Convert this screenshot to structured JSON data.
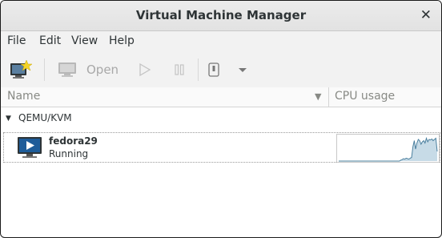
{
  "window": {
    "title": "Virtual Machine Manager"
  },
  "menu": {
    "file": "File",
    "edit": "Edit",
    "view": "View",
    "help": "Help"
  },
  "toolbar": {
    "open_label": "Open"
  },
  "columns": {
    "name": "Name",
    "cpu": "CPU usage"
  },
  "groups": [
    {
      "label": "QEMU/KVM",
      "vms": [
        {
          "name": "fedora29",
          "status": "Running",
          "cpu_history": [
            0,
            0,
            0,
            0,
            0,
            0,
            0,
            0,
            0,
            0,
            0,
            0,
            0,
            0,
            0,
            0,
            0,
            0,
            0,
            0,
            0,
            0,
            0,
            0,
            0,
            0,
            0,
            0,
            0,
            0,
            0,
            0,
            0,
            0,
            0,
            0,
            0,
            0,
            0,
            0,
            0,
            0,
            0,
            0,
            0,
            0,
            0.04,
            0.06,
            0.1,
            0.08,
            0.12,
            0.1,
            0.08,
            0.12,
            0.15,
            0.6,
            0.85,
            0.5,
            0.75,
            0.9,
            0.85,
            0.7,
            0.8,
            0.85,
            0.75,
            0.95,
            0.8,
            0.9,
            0.88,
            0.92,
            0.85,
            0.9,
            0.95,
            0.4
          ]
        }
      ]
    }
  ],
  "colors": {
    "graph_line": "#4a7f9e",
    "graph_fill": "#c7dbe7",
    "accent": "#1e5c99"
  }
}
